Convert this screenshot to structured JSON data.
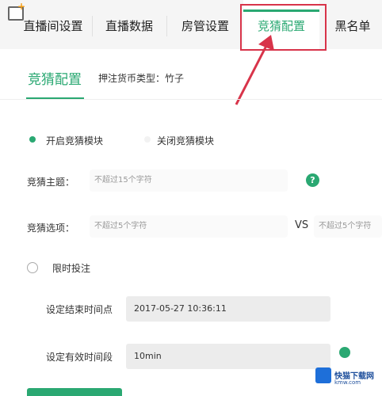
{
  "tabs": [
    {
      "label": "直播间设置",
      "active": false
    },
    {
      "label": "直播数据",
      "active": false
    },
    {
      "label": "房管设置",
      "active": false
    },
    {
      "label": "竞猜配置",
      "active": true
    },
    {
      "label": "黑名单",
      "active": false
    }
  ],
  "section": {
    "title": "竞猜配置",
    "currency": "押注货币类型：竹子"
  },
  "module": {
    "on_label": "开启竞猜模块",
    "off_label": "关闭竞猜模块",
    "selected": "on"
  },
  "topic": {
    "label": "竞猜主题：",
    "placeholder": "不超过15个字符",
    "help": "?"
  },
  "options": {
    "label": "竞猜选项：",
    "placeholder_left": "不超过5个字符",
    "vs": "VS",
    "placeholder_right": "不超过5个字符"
  },
  "timelimit": {
    "label": "限时投注",
    "checked": false
  },
  "end_time": {
    "label": "设定结束时间点",
    "value": "2017-05-27 10:36:11"
  },
  "duration": {
    "label": "设定有效时间段",
    "value": "10min"
  },
  "watermark": {
    "title": "快猫下载网",
    "sub": "kmw.com"
  },
  "colors": {
    "accent": "#2aa872",
    "highlight": "#d8344a"
  }
}
